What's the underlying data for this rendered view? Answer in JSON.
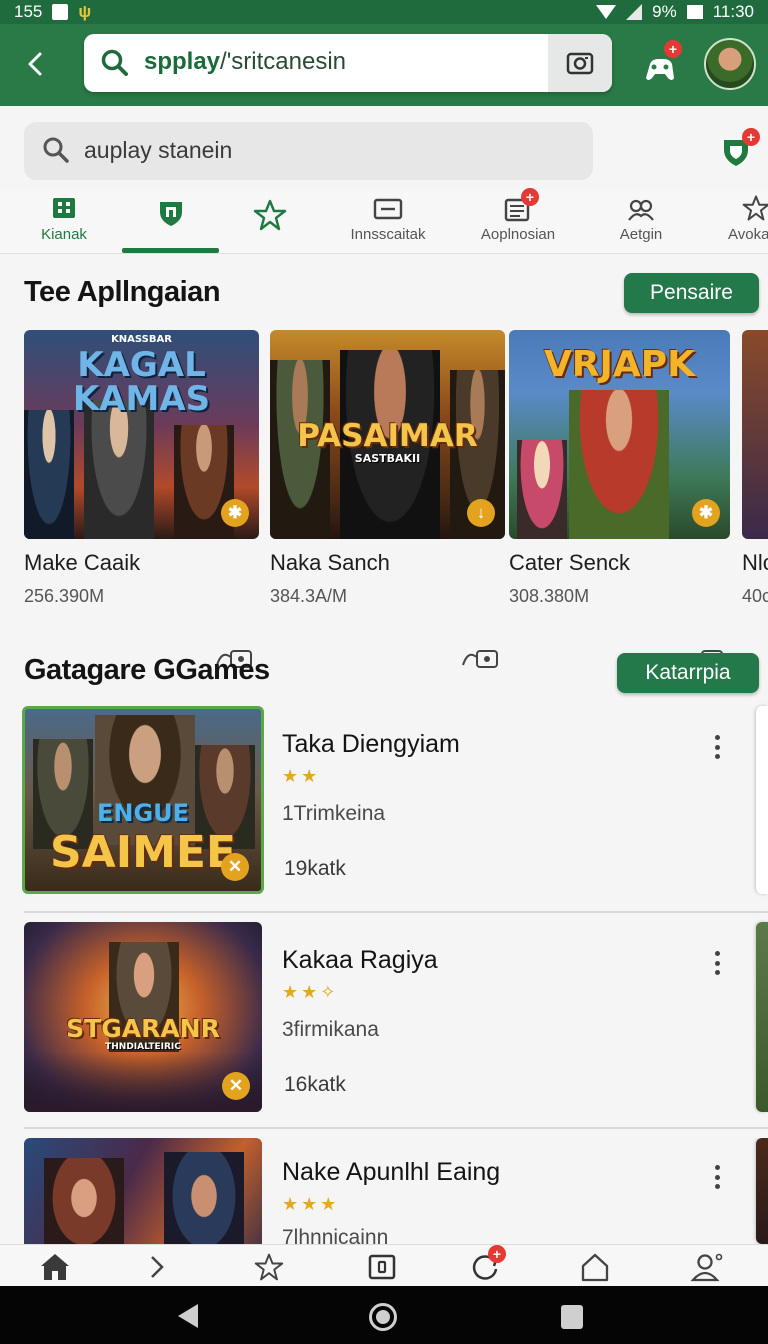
{
  "status_bar": {
    "left_text": "155",
    "battery_text": "9%",
    "time": "11:30"
  },
  "app_bar": {
    "search_query_bold": "spplay",
    "search_query_rest": "/'sritcanesin",
    "notification_badge": "+"
  },
  "search2": {
    "text": "auplay stanein",
    "shield_badge": "+"
  },
  "tabs": [
    {
      "label": "Kianak",
      "icon": "grid-icon"
    },
    {
      "label": "",
      "icon": "shield-icon"
    },
    {
      "label": "",
      "icon": "star-icon"
    },
    {
      "label": "Innsscaitak",
      "icon": "card-icon"
    },
    {
      "label": "Aoplnosian",
      "icon": "list-icon",
      "badge": "+"
    },
    {
      "label": "Aetgin",
      "icon": "people-icon"
    },
    {
      "label": "Avoka",
      "icon": "star-icon"
    }
  ],
  "section1": {
    "title": "Tee Apllngaian",
    "button": "Pensaire",
    "cards": [
      {
        "art_title": "KAGAL KAMAS",
        "art_sub": "KNASSBAR",
        "name": "Make Caaik",
        "size": "256.390M"
      },
      {
        "art_title": "PASAIMAR",
        "art_sub": "SASTBAKII",
        "name": "Naka Sanch",
        "size": "384.3A/M"
      },
      {
        "art_title": "VRJAPK",
        "art_sub": "",
        "name": "Cater Senck",
        "size": "308.380M"
      },
      {
        "art_title": "",
        "art_sub": "",
        "name": "Nlc",
        "size": "40c"
      }
    ]
  },
  "section2": {
    "title": "Gatagare GGames",
    "button": "Katarrpia",
    "items": [
      {
        "art_title": "ENGUE",
        "art_title2": "SAIMEE",
        "name": "Taka Diengyiam",
        "stars": "★★",
        "subtitle": "1Trimkeina",
        "count": "19katk"
      },
      {
        "art_title": "STGARANR",
        "art_title2": "THNDIALTEIRIC",
        "name": "Kakaa Ragiya",
        "stars": "★★✧",
        "subtitle": "3firmikana",
        "count": "16katk"
      },
      {
        "art_title": "",
        "art_title2": "",
        "name": "Nake Apunlhl Eaing",
        "stars": "★★★",
        "subtitle": "7lhnnicainn",
        "count": ""
      }
    ]
  },
  "bottom_nav": {
    "items": [
      "home-icon",
      "chevron-right-icon",
      "star-icon",
      "square-icon",
      "refresh-icon",
      "house-outline-icon",
      "profile-icon"
    ],
    "badge": "+"
  },
  "colors": {
    "primary": "#2a7a47",
    "accent_star": "#e5a91d",
    "badge": "#e53935"
  }
}
